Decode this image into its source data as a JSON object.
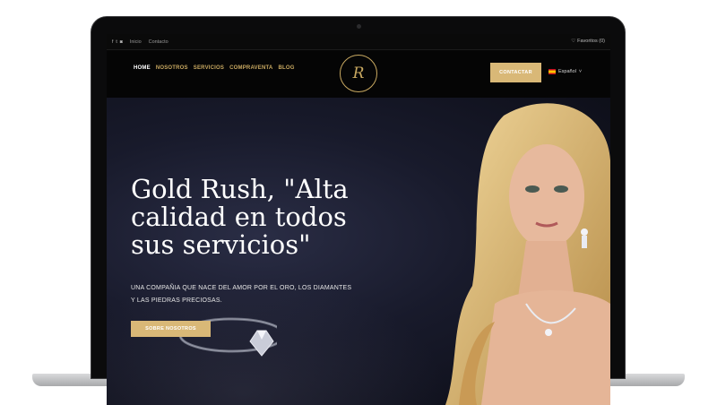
{
  "topbar": {
    "social_icons": [
      "facebook-icon",
      "twitter-icon",
      "instagram-icon"
    ],
    "links": [
      "Inicio",
      "Contacto"
    ],
    "favorites": "Favoritos (0)"
  },
  "nav": {
    "items": [
      {
        "label": "HOME",
        "active": true
      },
      {
        "label": "NOSOTROS",
        "active": false
      },
      {
        "label": "SERVICIOS",
        "active": false
      },
      {
        "label": "COMPRAVENTA",
        "active": false
      },
      {
        "label": "BLOG",
        "active": false
      }
    ],
    "logo_text": "R",
    "contact_label": "CONTACTAR",
    "language": "Español"
  },
  "hero": {
    "title": "Gold Rush, \"Alta calidad en todos sus servicios\"",
    "subtitle": "UNA COMPAÑIA QUE NACE DEL AMOR POR EL ORO, LOS DIAMANTES Y LAS PIEDRAS PRECIOSAS.",
    "button_label": "SOBRE NOSOTROS"
  },
  "colors": {
    "accent": "#d9b877",
    "gold_text": "#c9a961",
    "background": "#050505",
    "hero_bg": "#181a2b"
  }
}
